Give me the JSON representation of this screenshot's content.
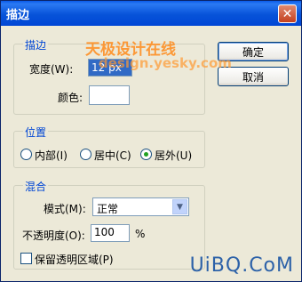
{
  "window": {
    "title": "描边"
  },
  "buttons": {
    "ok": "确定",
    "cancel": "取消"
  },
  "stroke": {
    "legend": "描边",
    "width_label": "宽度(W):",
    "width_value": "12 px",
    "color_label": "颜色:"
  },
  "position": {
    "legend": "位置",
    "options": [
      "内部(I)",
      "居中(C)",
      "居外(U)"
    ],
    "selected": "居外(U)"
  },
  "blend": {
    "legend": "混合",
    "mode_label": "模式(M):",
    "mode_value": "正常",
    "opacity_label": "不透明度(O):",
    "opacity_value": "100",
    "opacity_unit": "%",
    "preserve_label": "保留透明区域(P)"
  },
  "watermarks": {
    "cn": "天极设计在线",
    "url": "design.yesky.com",
    "site": "UiBQ.CoM"
  },
  "icons": {
    "close": "close-icon",
    "dropdown": "chevron-down-icon"
  }
}
